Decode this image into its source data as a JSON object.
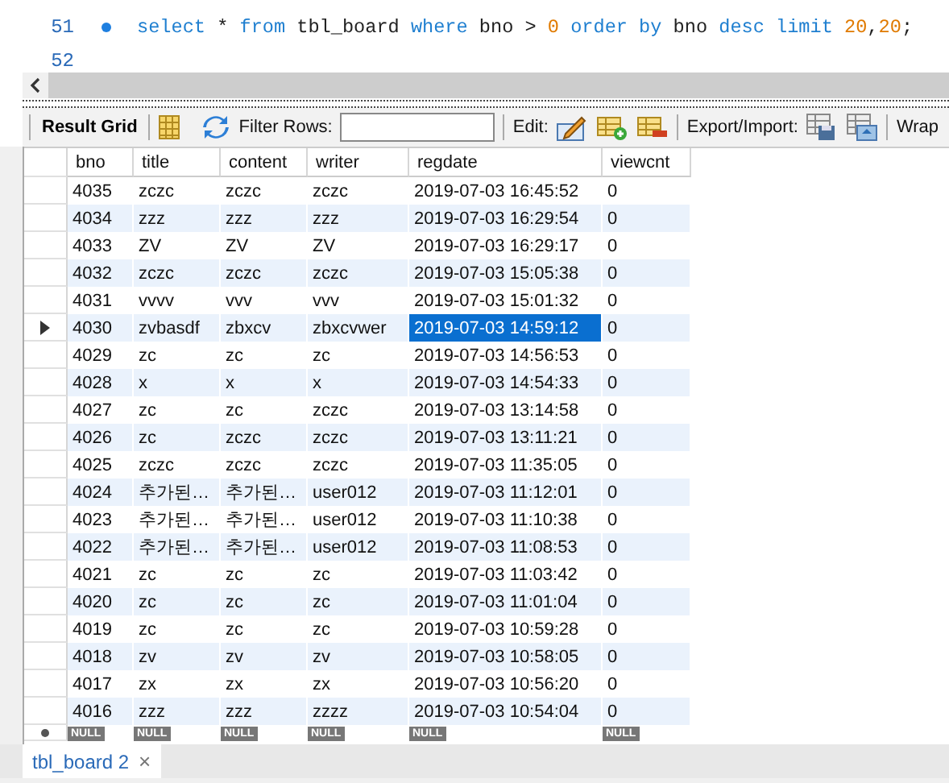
{
  "editor": {
    "lines": [
      {
        "number": "51",
        "marker": true,
        "tokens": [
          {
            "text": "select",
            "kind": "keyword"
          },
          {
            "text": " * ",
            "kind": "plain"
          },
          {
            "text": "from",
            "kind": "keyword"
          },
          {
            "text": " tbl_board ",
            "kind": "plain"
          },
          {
            "text": "where",
            "kind": "keyword"
          },
          {
            "text": " bno > ",
            "kind": "plain"
          },
          {
            "text": "0",
            "kind": "number"
          },
          {
            "text": " order by",
            "kind": "keyword"
          },
          {
            "text": " bno ",
            "kind": "plain"
          },
          {
            "text": "desc limit",
            "kind": "keyword"
          },
          {
            "text": " 20",
            "kind": "number"
          },
          {
            "text": ",",
            "kind": "plain"
          },
          {
            "text": "20",
            "kind": "number"
          },
          {
            "text": ";",
            "kind": "plain"
          }
        ]
      },
      {
        "number": "52"
      }
    ]
  },
  "toolbar": {
    "result_grid": "Result Grid",
    "filter_label": "Filter Rows:",
    "edit_label": "Edit:",
    "export_label": "Export/Import:",
    "wrap_label": "Wrap"
  },
  "grid": {
    "columns": [
      {
        "name": "bno",
        "focused": false
      },
      {
        "name": "title",
        "focused": false
      },
      {
        "name": "content",
        "focused": false
      },
      {
        "name": "writer",
        "focused": false
      },
      {
        "name": "regdate",
        "focused": true
      },
      {
        "name": "viewcnt",
        "focused": false
      }
    ],
    "rows": [
      {
        "selected": false,
        "cells": [
          "4035",
          "zczc",
          "zczc",
          "zczc",
          "2019-07-03 16:45:52",
          "0"
        ]
      },
      {
        "selected": false,
        "cells": [
          "4034",
          "zzz",
          "zzz",
          "zzz",
          "2019-07-03 16:29:54",
          "0"
        ]
      },
      {
        "selected": false,
        "cells": [
          "4033",
          "ZV",
          "ZV",
          "ZV",
          "2019-07-03 16:29:17",
          "0"
        ]
      },
      {
        "selected": false,
        "cells": [
          "4032",
          "zczc",
          "zczc",
          "zczc",
          "2019-07-03 15:05:38",
          "0"
        ]
      },
      {
        "selected": false,
        "cells": [
          "4031",
          "vvvv",
          "vvv",
          "vvv",
          "2019-07-03 15:01:32",
          "0"
        ]
      },
      {
        "selected": true,
        "cells": [
          "4030",
          "zvbasdf",
          "zbxcv",
          "zbxcvwer",
          "2019-07-03 14:59:12",
          "0"
        ]
      },
      {
        "selected": false,
        "cells": [
          "4029",
          "zc",
          "zc",
          "zc",
          "2019-07-03 14:56:53",
          "0"
        ]
      },
      {
        "selected": false,
        "cells": [
          "4028",
          "x",
          "x",
          "x",
          "2019-07-03 14:54:33",
          "0"
        ]
      },
      {
        "selected": false,
        "cells": [
          "4027",
          "zc",
          "zc",
          "zczc",
          "2019-07-03 13:14:58",
          "0"
        ]
      },
      {
        "selected": false,
        "cells": [
          "4026",
          "zc",
          "zczc",
          "zczc",
          "2019-07-03 13:11:21",
          "0"
        ]
      },
      {
        "selected": false,
        "cells": [
          "4025",
          "zczc",
          "zczc",
          "zczc",
          "2019-07-03 11:35:05",
          "0"
        ]
      },
      {
        "selected": false,
        "cells": [
          "4024",
          "추가된…",
          "추가된…",
          "user012",
          "2019-07-03 11:12:01",
          "0"
        ]
      },
      {
        "selected": false,
        "cells": [
          "4023",
          "추가된…",
          "추가된…",
          "user012",
          "2019-07-03 11:10:38",
          "0"
        ]
      },
      {
        "selected": false,
        "cells": [
          "4022",
          "추가된…",
          "추가된…",
          "user012",
          "2019-07-03 11:08:53",
          "0"
        ]
      },
      {
        "selected": false,
        "cells": [
          "4021",
          "zc",
          "zc",
          "zc",
          "2019-07-03 11:03:42",
          "0"
        ]
      },
      {
        "selected": false,
        "cells": [
          "4020",
          "zc",
          "zc",
          "zc",
          "2019-07-03 11:01:04",
          "0"
        ]
      },
      {
        "selected": false,
        "cells": [
          "4019",
          "zc",
          "zc",
          "zc",
          "2019-07-03 10:59:28",
          "0"
        ]
      },
      {
        "selected": false,
        "cells": [
          "4018",
          "zv",
          "zv",
          "zv",
          "2019-07-03 10:58:05",
          "0"
        ]
      },
      {
        "selected": false,
        "cells": [
          "4017",
          "zx",
          "zx",
          "zx",
          "2019-07-03 10:56:20",
          "0"
        ]
      },
      {
        "selected": false,
        "cells": [
          "4016",
          "zzz",
          "zzz",
          "zzzz",
          "2019-07-03 10:54:04",
          "0"
        ]
      }
    ],
    "new_row": [
      "NULL",
      "NULL",
      "NULL",
      "NULL",
      "NULL",
      "NULL"
    ]
  },
  "result_tabs": [
    {
      "label": "tbl_board 2",
      "close": "×",
      "selected": true
    }
  ]
}
